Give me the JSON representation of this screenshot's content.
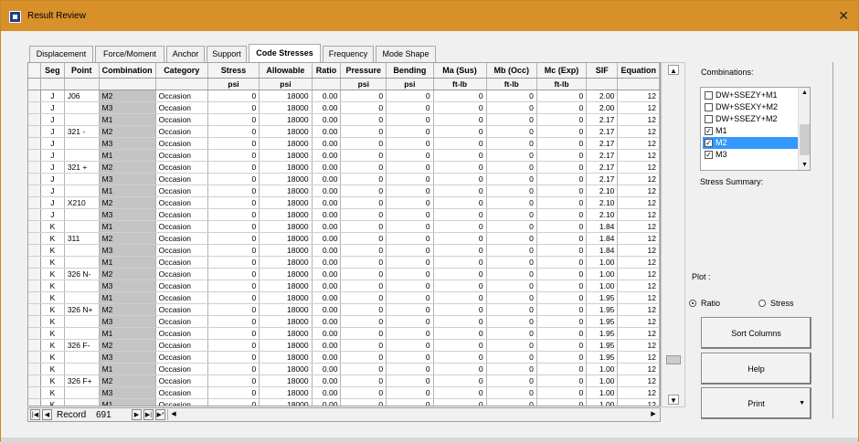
{
  "window": {
    "title": "Result Review",
    "close_glyph": "✕"
  },
  "tabs": [
    {
      "label": "Displacement"
    },
    {
      "label": "Force/Moment"
    },
    {
      "label": "Anchor"
    },
    {
      "label": "Support"
    },
    {
      "label": "Code Stresses"
    },
    {
      "label": "Frequency"
    },
    {
      "label": "Mode Shape"
    }
  ],
  "active_tab": "Code Stresses",
  "grid": {
    "columns": [
      "Seg",
      "Point",
      "Combination",
      "Category",
      "Stress",
      "Allowable",
      "Ratio",
      "Pressure",
      "Bending",
      "Ma (Sus)",
      "Mb (Occ)",
      "Mc (Exp)",
      "SIF",
      "Equation"
    ],
    "units": [
      "",
      "",
      "",
      "",
      "psi",
      "psi",
      "",
      "psi",
      "psi",
      "ft-lb",
      "ft-lb",
      "ft-lb",
      "",
      ""
    ],
    "rows": [
      [
        "J",
        "J06",
        "M2",
        "Occasion",
        "0",
        "18000",
        "0.00",
        "0",
        "0",
        "0",
        "0",
        "0",
        "2.00",
        "12"
      ],
      [
        "J",
        "",
        "M3",
        "Occasion",
        "0",
        "18000",
        "0.00",
        "0",
        "0",
        "0",
        "0",
        "0",
        "2.00",
        "12"
      ],
      [
        "J",
        "",
        "M1",
        "Occasion",
        "0",
        "18000",
        "0.00",
        "0",
        "0",
        "0",
        "0",
        "0",
        "2.17",
        "12"
      ],
      [
        "J",
        "321 -",
        "M2",
        "Occasion",
        "0",
        "18000",
        "0.00",
        "0",
        "0",
        "0",
        "0",
        "0",
        "2.17",
        "12"
      ],
      [
        "J",
        "",
        "M3",
        "Occasion",
        "0",
        "18000",
        "0.00",
        "0",
        "0",
        "0",
        "0",
        "0",
        "2.17",
        "12"
      ],
      [
        "J",
        "",
        "M1",
        "Occasion",
        "0",
        "18000",
        "0.00",
        "0",
        "0",
        "0",
        "0",
        "0",
        "2.17",
        "12"
      ],
      [
        "J",
        "321 +",
        "M2",
        "Occasion",
        "0",
        "18000",
        "0.00",
        "0",
        "0",
        "0",
        "0",
        "0",
        "2.17",
        "12"
      ],
      [
        "J",
        "",
        "M3",
        "Occasion",
        "0",
        "18000",
        "0.00",
        "0",
        "0",
        "0",
        "0",
        "0",
        "2.17",
        "12"
      ],
      [
        "J",
        "",
        "M1",
        "Occasion",
        "0",
        "18000",
        "0.00",
        "0",
        "0",
        "0",
        "0",
        "0",
        "2.10",
        "12"
      ],
      [
        "J",
        "X210",
        "M2",
        "Occasion",
        "0",
        "18000",
        "0.00",
        "0",
        "0",
        "0",
        "0",
        "0",
        "2.10",
        "12"
      ],
      [
        "J",
        "",
        "M3",
        "Occasion",
        "0",
        "18000",
        "0.00",
        "0",
        "0",
        "0",
        "0",
        "0",
        "2.10",
        "12"
      ],
      [
        "K",
        "",
        "M1",
        "Occasion",
        "0",
        "18000",
        "0.00",
        "0",
        "0",
        "0",
        "0",
        "0",
        "1.84",
        "12"
      ],
      [
        "K",
        "311",
        "M2",
        "Occasion",
        "0",
        "18000",
        "0.00",
        "0",
        "0",
        "0",
        "0",
        "0",
        "1.84",
        "12"
      ],
      [
        "K",
        "",
        "M3",
        "Occasion",
        "0",
        "18000",
        "0.00",
        "0",
        "0",
        "0",
        "0",
        "0",
        "1.84",
        "12"
      ],
      [
        "K",
        "",
        "M1",
        "Occasion",
        "0",
        "18000",
        "0.00",
        "0",
        "0",
        "0",
        "0",
        "0",
        "1.00",
        "12"
      ],
      [
        "K",
        "326 N-",
        "M2",
        "Occasion",
        "0",
        "18000",
        "0.00",
        "0",
        "0",
        "0",
        "0",
        "0",
        "1.00",
        "12"
      ],
      [
        "K",
        "",
        "M3",
        "Occasion",
        "0",
        "18000",
        "0.00",
        "0",
        "0",
        "0",
        "0",
        "0",
        "1.00",
        "12"
      ],
      [
        "K",
        "",
        "M1",
        "Occasion",
        "0",
        "18000",
        "0.00",
        "0",
        "0",
        "0",
        "0",
        "0",
        "1.95",
        "12"
      ],
      [
        "K",
        "326 N+",
        "M2",
        "Occasion",
        "0",
        "18000",
        "0.00",
        "0",
        "0",
        "0",
        "0",
        "0",
        "1.95",
        "12"
      ],
      [
        "K",
        "",
        "M3",
        "Occasion",
        "0",
        "18000",
        "0.00",
        "0",
        "0",
        "0",
        "0",
        "0",
        "1.95",
        "12"
      ],
      [
        "K",
        "",
        "M1",
        "Occasion",
        "0",
        "18000",
        "0.00",
        "0",
        "0",
        "0",
        "0",
        "0",
        "1.95",
        "12"
      ],
      [
        "K",
        "326 F-",
        "M2",
        "Occasion",
        "0",
        "18000",
        "0.00",
        "0",
        "0",
        "0",
        "0",
        "0",
        "1.95",
        "12"
      ],
      [
        "K",
        "",
        "M3",
        "Occasion",
        "0",
        "18000",
        "0.00",
        "0",
        "0",
        "0",
        "0",
        "0",
        "1.95",
        "12"
      ],
      [
        "K",
        "",
        "M1",
        "Occasion",
        "0",
        "18000",
        "0.00",
        "0",
        "0",
        "0",
        "0",
        "0",
        "1.00",
        "12"
      ],
      [
        "K",
        "326 F+",
        "M2",
        "Occasion",
        "0",
        "18000",
        "0.00",
        "0",
        "0",
        "0",
        "0",
        "0",
        "1.00",
        "12"
      ],
      [
        "K",
        "",
        "M3",
        "Occasion",
        "0",
        "18000",
        "0.00",
        "0",
        "0",
        "0",
        "0",
        "0",
        "1.00",
        "12"
      ],
      [
        "K",
        "",
        "M1",
        "Occasion",
        "0",
        "18000",
        "0.00",
        "0",
        "0",
        "0",
        "0",
        "0",
        "1.00",
        "12"
      ]
    ]
  },
  "record_nav": {
    "label": "Record",
    "value": "691"
  },
  "side": {
    "combinations_label": "Combinations:",
    "combinations": [
      {
        "label": "DW+SSEZY+M1",
        "checked": false,
        "selected": false
      },
      {
        "label": "DW+SSEXY+M2",
        "checked": false,
        "selected": false
      },
      {
        "label": "DW+SSEZY+M2",
        "checked": false,
        "selected": false
      },
      {
        "label": "M1",
        "checked": true,
        "selected": false
      },
      {
        "label": "M2",
        "checked": true,
        "selected": true
      },
      {
        "label": "M3",
        "checked": true,
        "selected": false
      }
    ],
    "stress_summary_label": "Stress Summary:",
    "plot_label": "Plot :",
    "plot_options": [
      {
        "label": "Ratio",
        "selected": true
      },
      {
        "label": "Stress",
        "selected": false
      }
    ],
    "sort_columns_label": "Sort Columns",
    "help_label": "Help",
    "print_label": "Print"
  },
  "colors": {
    "titlebar": "#d7902a",
    "selection": "#3399ff",
    "combination_cell": "#c4c4c4"
  }
}
